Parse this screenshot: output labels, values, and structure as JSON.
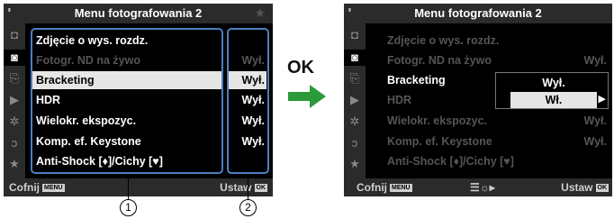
{
  "left_screen": {
    "title": "Menu fotografowania 2",
    "battery": "ᴵᴵᴵᴵ",
    "tab_icons": [
      "camera-1-icon",
      "camera-2-icon",
      "video-icon",
      "playback-icon",
      "gear-icon",
      "wrench-icon",
      "star-icon"
    ],
    "items": [
      {
        "label": "Zdjęcie o wys. rozdz.",
        "value": ""
      },
      {
        "label": "Fotogr. ND na żywo",
        "value": "Wył."
      },
      {
        "label": "Bracketing",
        "value": "Wył."
      },
      {
        "label": "HDR",
        "value": "Wył."
      },
      {
        "label": "Wielokr. ekspozyc.",
        "value": "Wył."
      },
      {
        "label": "Komp. ef. Keystone",
        "value": "Wył."
      },
      {
        "label": "Anti-Shock [♦]/Cichy [♥]",
        "value": ""
      }
    ],
    "back_label": "Cofnij",
    "back_key": "MENU",
    "set_label": "Ustaw",
    "set_key": "OK"
  },
  "callouts": {
    "one": "1",
    "two": "2"
  },
  "transition": {
    "label": "OK",
    "arrow_color": "#2a9a3a"
  },
  "right_screen": {
    "title": "Menu fotografowania 2",
    "items": [
      {
        "label": "Zdjęcie o wys. rozdz.",
        "value": ""
      },
      {
        "label": "Fotogr. ND na żywo",
        "value": "Wył."
      },
      {
        "label": "Bracketing",
        "value": ""
      },
      {
        "label": "HDR",
        "value": ""
      },
      {
        "label": "Wielokr. ekspozyc.",
        "value": "Wył."
      },
      {
        "label": "Komp. ef. Keystone",
        "value": "Wył."
      },
      {
        "label": "Anti-Shock [♦]/Cichy [♥]",
        "value": ""
      }
    ],
    "popup_options": [
      "Wył.",
      "Wł."
    ],
    "popup_selected": "Wł.",
    "back_label": "Cofnij",
    "back_key": "MENU",
    "info_icon": "display-settings-icon",
    "set_label": "Ustaw",
    "set_key": "OK"
  },
  "colors": {
    "highlight": "#e6e6e6",
    "bracket": "#4a7fc1",
    "bars": "#2b2b2b"
  }
}
